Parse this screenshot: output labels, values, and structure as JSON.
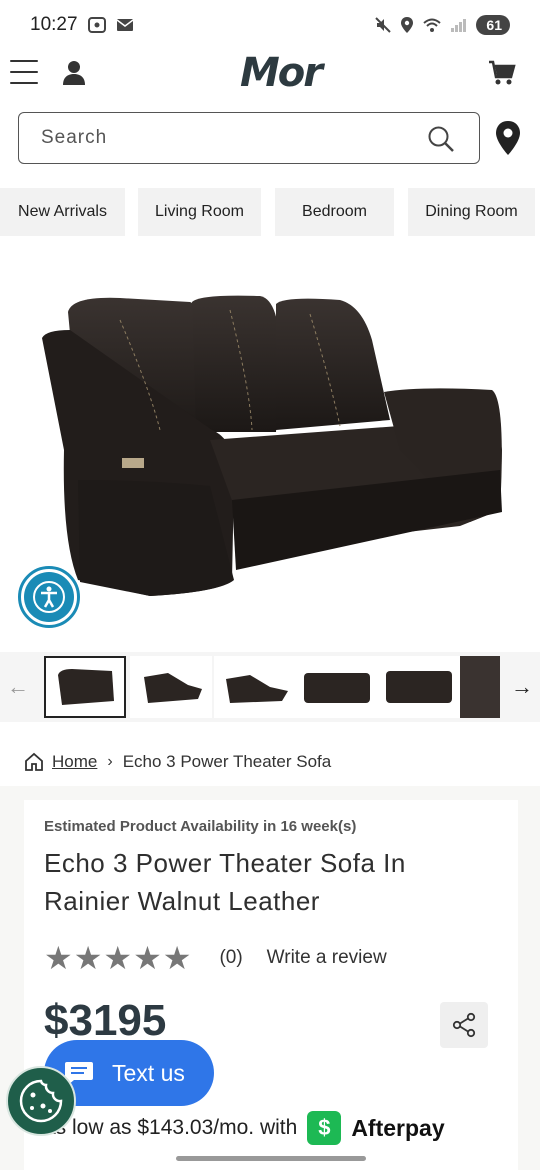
{
  "status_bar": {
    "time": "10:27",
    "battery": "61",
    "icons": [
      "screenshot-icon",
      "mail-icon",
      "mute-icon",
      "location-icon",
      "wifi-icon",
      "signal-icon"
    ]
  },
  "header": {
    "logo": "Mor",
    "icons": [
      "menu-icon",
      "user-icon",
      "cart-icon"
    ]
  },
  "search": {
    "placeholder": "Search"
  },
  "categories": [
    "New Arrivals",
    "Living Room",
    "Bedroom",
    "Dining Room"
  ],
  "product_image": {
    "alt": "sofa-photo"
  },
  "thumbnails": {
    "count_visible": 6,
    "selected_index": 0
  },
  "breadcrumb": {
    "home": "Home",
    "current": "Echo 3 Power Theater Sofa"
  },
  "product": {
    "availability": "Estimated Product Availability in 16 week(s)",
    "title": "Echo 3 Power Theater Sofa In Rainier Walnut Leather",
    "rating_stars": 5,
    "rating_value": 0,
    "review_count": "(0)",
    "write_review": "Write a review",
    "price": "$3195"
  },
  "text_us": {
    "label": "Text us"
  },
  "afterpay": {
    "text": "as low as $143.03/mo. with",
    "badge": "$",
    "brand": "Afterpay"
  },
  "colors": {
    "accent_blue": "#2f76e8",
    "a11y_blue": "#1a8bb6",
    "cookie_green": "#1f5e4a",
    "afterpay_green": "#1db954",
    "price_color": "#2d3a42"
  }
}
